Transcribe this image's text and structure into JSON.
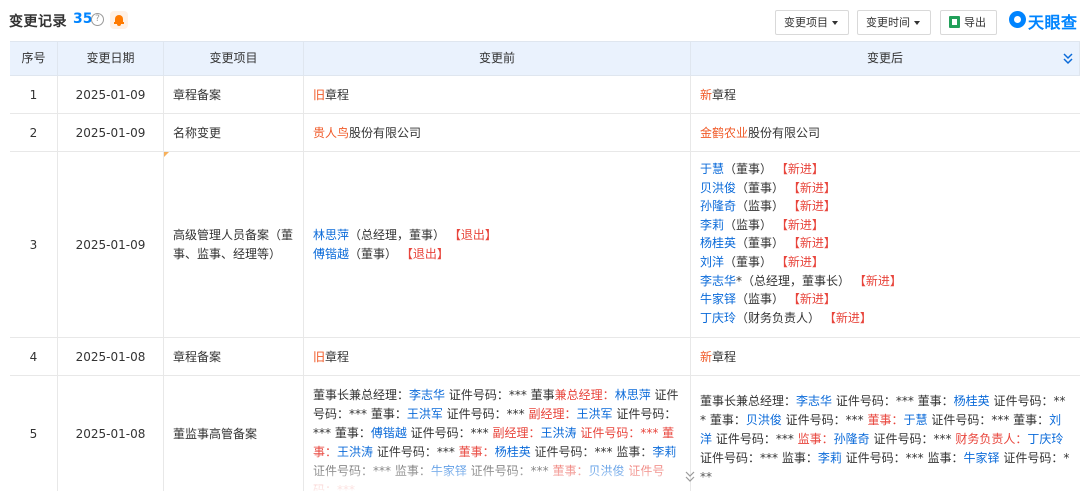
{
  "header": {
    "title": "变更记录",
    "count": "35",
    "help_glyph": "?",
    "bell_icon": "bell-icon",
    "buttons": {
      "change_item": "变更项目",
      "change_time": "变更时间",
      "export": "导出"
    },
    "logo_text": "天眼查"
  },
  "table": {
    "columns": [
      "序号",
      "变更日期",
      "变更项目",
      "变更前",
      "变更后"
    ],
    "rows": [
      {
        "no": "1",
        "date": "2025-01-09",
        "item": "章程备案",
        "before": {
          "hl": "旧",
          "rest": "章程"
        },
        "after": {
          "hl": "新",
          "rest": "章程"
        }
      },
      {
        "no": "2",
        "date": "2025-01-09",
        "item": "名称变更",
        "before": {
          "hl": "贵人鸟",
          "rest": "股份有限公司"
        },
        "after": {
          "hl": "金鹤农业",
          "rest": "股份有限公司"
        }
      },
      {
        "no": "3",
        "date": "2025-01-09",
        "item": "高级管理人员备案（董事、监事、经理等）",
        "before": [
          {
            "name": "林思萍",
            "role": "（总经理，董事）",
            "tag": "【退出】"
          },
          {
            "name": "傅锴越",
            "role": "（董事）",
            "tag": "【退出】"
          }
        ],
        "after": [
          {
            "name": "于慧",
            "role": "（董事）",
            "tag": "【新进】"
          },
          {
            "name": "贝洪俊",
            "role": "（董事）",
            "tag": "【新进】"
          },
          {
            "name": "孙隆奇",
            "role": "（监事）",
            "tag": "【新进】"
          },
          {
            "name": "李莉",
            "role": "（监事）",
            "tag": "【新进】"
          },
          {
            "name": "杨桂英",
            "role": "（董事）",
            "tag": "【新进】"
          },
          {
            "name": "刘洋",
            "role": "（董事）",
            "tag": "【新进】"
          },
          {
            "name": "李志华",
            "role": "*（总经理，董事长）",
            "tag": "【新进】"
          },
          {
            "name": "牛家铎",
            "role": "（监事）",
            "tag": "【新进】"
          },
          {
            "name": "丁庆玲",
            "role": "（财务负责人）",
            "tag": "【新进】"
          }
        ]
      },
      {
        "no": "4",
        "date": "2025-01-08",
        "item": "章程备案",
        "before": {
          "hl": "旧",
          "rest": "章程"
        },
        "after": {
          "hl": "新",
          "rest": "章程"
        }
      },
      {
        "no": "5",
        "date": "2025-01-08",
        "item": "董监事高管备案",
        "before": [
          {
            "t": "n",
            "s": "董事长兼总经理："
          },
          {
            "t": "b",
            "s": "李志华"
          },
          {
            "t": "n",
            "s": " 证件号码：*** 董事"
          },
          {
            "t": "r",
            "s": "兼总经理："
          },
          {
            "t": "b",
            "s": "林思萍"
          },
          {
            "t": "n",
            "s": " 证件号码：*** 董事："
          },
          {
            "t": "b",
            "s": "王洪军"
          },
          {
            "t": "n",
            "s": " 证件号码：*** "
          },
          {
            "t": "r",
            "s": "副经理："
          },
          {
            "t": "b",
            "s": "王洪军"
          },
          {
            "t": "n",
            "s": " 证件号码：*** 董事："
          },
          {
            "t": "b",
            "s": "傅锴越"
          },
          {
            "t": "n",
            "s": " 证件号码：*** "
          },
          {
            "t": "r",
            "s": "副经理："
          },
          {
            "t": "b",
            "s": "王洪涛"
          },
          {
            "t": "r",
            "s": " 证件号码：*** 董事："
          },
          {
            "t": "b",
            "s": "王洪涛"
          },
          {
            "t": "n",
            "s": " 证件号码：*** "
          },
          {
            "t": "r",
            "s": "董事："
          },
          {
            "t": "b",
            "s": "杨桂英"
          },
          {
            "t": "n",
            "s": " 证件号码：*** 监事："
          },
          {
            "t": "b",
            "s": "李莉"
          },
          {
            "t": "n",
            "s": " 证件号码：*** 监事："
          },
          {
            "t": "b",
            "s": "牛家铎"
          },
          {
            "t": "n",
            "s": " 证件号码：*** "
          },
          {
            "t": "r",
            "s": "董事："
          },
          {
            "t": "b",
            "s": "贝洪俊"
          },
          {
            "t": "r",
            "s": " 证件号码：***"
          }
        ],
        "after": [
          {
            "t": "n",
            "s": "董事长兼总经理："
          },
          {
            "t": "b",
            "s": "李志华"
          },
          {
            "t": "n",
            "s": " 证件号码：*** 董事："
          },
          {
            "t": "b",
            "s": "杨桂英"
          },
          {
            "t": "n",
            "s": " 证件号码：*** 董事："
          },
          {
            "t": "b",
            "s": "贝洪俊"
          },
          {
            "t": "n",
            "s": " 证件号码：*** "
          },
          {
            "t": "r",
            "s": "董事："
          },
          {
            "t": "b",
            "s": "于慧"
          },
          {
            "t": "n",
            "s": " 证件号码：*** 董事："
          },
          {
            "t": "b",
            "s": "刘洋"
          },
          {
            "t": "n",
            "s": " 证件号码：*** "
          },
          {
            "t": "r",
            "s": "监事："
          },
          {
            "t": "b",
            "s": "孙隆奇"
          },
          {
            "t": "n",
            "s": " 证件号码：*** "
          },
          {
            "t": "r",
            "s": "财务负责人："
          },
          {
            "t": "b",
            "s": "丁庆玲"
          },
          {
            "t": "n",
            "s": " 证件号码：*** 监事："
          },
          {
            "t": "b",
            "s": "李莉"
          },
          {
            "t": "n",
            "s": " 证件号码：*** 监事："
          },
          {
            "t": "b",
            "s": "牛家铎"
          },
          {
            "t": "n",
            "s": " 证件号码：***"
          }
        ]
      }
    ]
  },
  "colors": {
    "accent_blue": "#0084ff",
    "link_blue": "#0a6ad9",
    "highlight_red": "#e8453c",
    "header_bg": "#eaf2fd"
  }
}
